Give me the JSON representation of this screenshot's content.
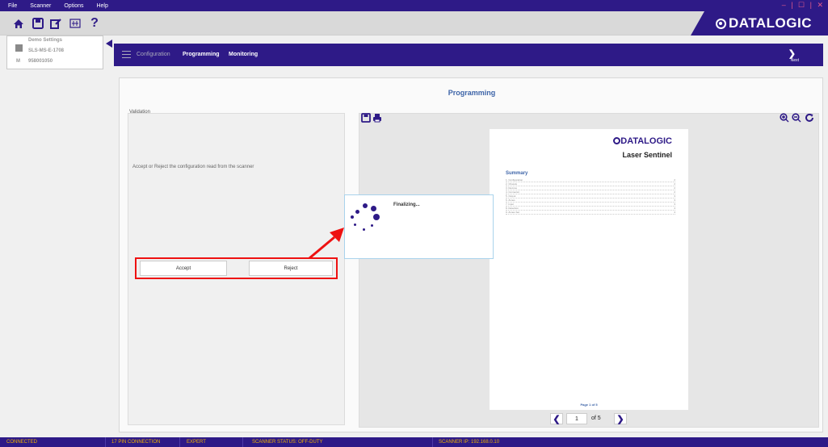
{
  "menu": {
    "items": [
      "File",
      "Scanner",
      "Options",
      "Help"
    ]
  },
  "window": {
    "controls": "– | ☐ | ✕"
  },
  "brand": {
    "name": "DATALOGIC"
  },
  "device": {
    "name": "Demo Settings",
    "model": "SLS-MS-E-1708",
    "serial_prefix": "M",
    "serial": "958001050"
  },
  "nav": {
    "items": [
      "Configuration",
      "Programming",
      "Monitoring"
    ],
    "active": "Programming",
    "next_label": "Next"
  },
  "page": {
    "title": "Programming",
    "validation_label": "Validation",
    "validation_message": "Accept or Reject the configuration read from the scanner",
    "accept_label": "Accept",
    "reject_label": "Reject"
  },
  "dialog": {
    "text": "Finalizing..."
  },
  "document": {
    "brand": "DATALOGIC",
    "product": "Laser Sentinel",
    "summary_heading": "Summary",
    "toc": [
      {
        "label": "1. Configuration",
        "page": "2"
      },
      {
        "label": "2. Chassis",
        "page": "2"
      },
      {
        "label": "3. Devices",
        "page": "2"
      },
      {
        "label": "4. Connector",
        "page": "2"
      },
      {
        "label": "5. Output",
        "page": "3"
      },
      {
        "label": "6. Zones",
        "page": "3"
      },
      {
        "label": "7. Input",
        "page": "3"
      },
      {
        "label": "8. Detection",
        "page": "4"
      },
      {
        "label": "9. Zones Set",
        "page": "4"
      }
    ],
    "footer": "Page 1 of 5"
  },
  "pager": {
    "current": "1",
    "of_label": "of 5"
  },
  "status": {
    "connection": "CONNECTED",
    "pin": "17 PIN CONNECTION",
    "mode": "EXPERT",
    "scanner_status": "SCANNER STATUS: OFF-DUTY",
    "ip": "SCANNER IP: 192.168.0.10"
  },
  "colors": {
    "brand_blue": "#2e1a87",
    "accent_red": "#e11111",
    "title_blue": "#3d64a8",
    "status_highlight": "#f0b400"
  },
  "icons": [
    "home-icon",
    "save-icon",
    "write-icon",
    "scanner-icon",
    "help-icon",
    "menu-icon",
    "next-icon",
    "save-icon",
    "print-icon",
    "zoom-in-icon",
    "zoom-out-icon",
    "refresh-icon",
    "chevron-left-icon",
    "chevron-right-icon",
    "spinner-icon"
  ]
}
